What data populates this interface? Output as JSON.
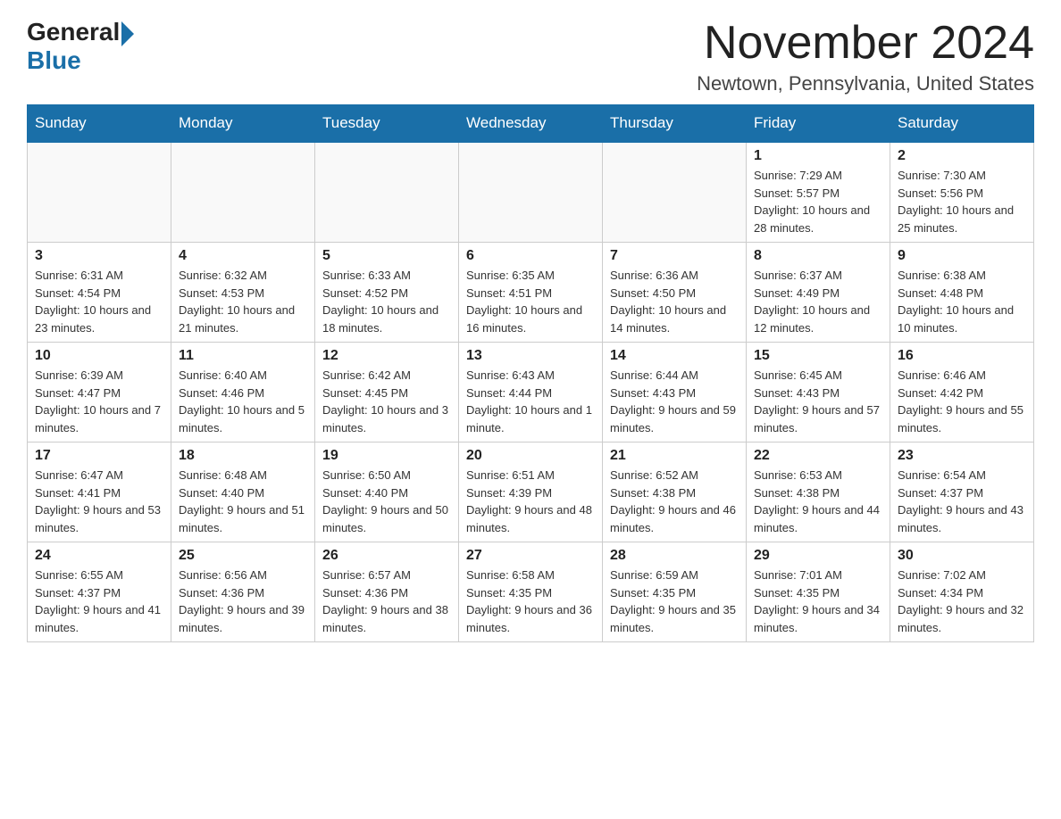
{
  "header": {
    "logo_general": "General",
    "logo_blue": "Blue",
    "month_title": "November 2024",
    "location": "Newtown, Pennsylvania, United States"
  },
  "weekdays": [
    "Sunday",
    "Monday",
    "Tuesday",
    "Wednesday",
    "Thursday",
    "Friday",
    "Saturday"
  ],
  "weeks": [
    {
      "days": [
        {
          "number": "",
          "info": ""
        },
        {
          "number": "",
          "info": ""
        },
        {
          "number": "",
          "info": ""
        },
        {
          "number": "",
          "info": ""
        },
        {
          "number": "",
          "info": ""
        },
        {
          "number": "1",
          "info": "Sunrise: 7:29 AM\nSunset: 5:57 PM\nDaylight: 10 hours and 28 minutes."
        },
        {
          "number": "2",
          "info": "Sunrise: 7:30 AM\nSunset: 5:56 PM\nDaylight: 10 hours and 25 minutes."
        }
      ]
    },
    {
      "days": [
        {
          "number": "3",
          "info": "Sunrise: 6:31 AM\nSunset: 4:54 PM\nDaylight: 10 hours and 23 minutes."
        },
        {
          "number": "4",
          "info": "Sunrise: 6:32 AM\nSunset: 4:53 PM\nDaylight: 10 hours and 21 minutes."
        },
        {
          "number": "5",
          "info": "Sunrise: 6:33 AM\nSunset: 4:52 PM\nDaylight: 10 hours and 18 minutes."
        },
        {
          "number": "6",
          "info": "Sunrise: 6:35 AM\nSunset: 4:51 PM\nDaylight: 10 hours and 16 minutes."
        },
        {
          "number": "7",
          "info": "Sunrise: 6:36 AM\nSunset: 4:50 PM\nDaylight: 10 hours and 14 minutes."
        },
        {
          "number": "8",
          "info": "Sunrise: 6:37 AM\nSunset: 4:49 PM\nDaylight: 10 hours and 12 minutes."
        },
        {
          "number": "9",
          "info": "Sunrise: 6:38 AM\nSunset: 4:48 PM\nDaylight: 10 hours and 10 minutes."
        }
      ]
    },
    {
      "days": [
        {
          "number": "10",
          "info": "Sunrise: 6:39 AM\nSunset: 4:47 PM\nDaylight: 10 hours and 7 minutes."
        },
        {
          "number": "11",
          "info": "Sunrise: 6:40 AM\nSunset: 4:46 PM\nDaylight: 10 hours and 5 minutes."
        },
        {
          "number": "12",
          "info": "Sunrise: 6:42 AM\nSunset: 4:45 PM\nDaylight: 10 hours and 3 minutes."
        },
        {
          "number": "13",
          "info": "Sunrise: 6:43 AM\nSunset: 4:44 PM\nDaylight: 10 hours and 1 minute."
        },
        {
          "number": "14",
          "info": "Sunrise: 6:44 AM\nSunset: 4:43 PM\nDaylight: 9 hours and 59 minutes."
        },
        {
          "number": "15",
          "info": "Sunrise: 6:45 AM\nSunset: 4:43 PM\nDaylight: 9 hours and 57 minutes."
        },
        {
          "number": "16",
          "info": "Sunrise: 6:46 AM\nSunset: 4:42 PM\nDaylight: 9 hours and 55 minutes."
        }
      ]
    },
    {
      "days": [
        {
          "number": "17",
          "info": "Sunrise: 6:47 AM\nSunset: 4:41 PM\nDaylight: 9 hours and 53 minutes."
        },
        {
          "number": "18",
          "info": "Sunrise: 6:48 AM\nSunset: 4:40 PM\nDaylight: 9 hours and 51 minutes."
        },
        {
          "number": "19",
          "info": "Sunrise: 6:50 AM\nSunset: 4:40 PM\nDaylight: 9 hours and 50 minutes."
        },
        {
          "number": "20",
          "info": "Sunrise: 6:51 AM\nSunset: 4:39 PM\nDaylight: 9 hours and 48 minutes."
        },
        {
          "number": "21",
          "info": "Sunrise: 6:52 AM\nSunset: 4:38 PM\nDaylight: 9 hours and 46 minutes."
        },
        {
          "number": "22",
          "info": "Sunrise: 6:53 AM\nSunset: 4:38 PM\nDaylight: 9 hours and 44 minutes."
        },
        {
          "number": "23",
          "info": "Sunrise: 6:54 AM\nSunset: 4:37 PM\nDaylight: 9 hours and 43 minutes."
        }
      ]
    },
    {
      "days": [
        {
          "number": "24",
          "info": "Sunrise: 6:55 AM\nSunset: 4:37 PM\nDaylight: 9 hours and 41 minutes."
        },
        {
          "number": "25",
          "info": "Sunrise: 6:56 AM\nSunset: 4:36 PM\nDaylight: 9 hours and 39 minutes."
        },
        {
          "number": "26",
          "info": "Sunrise: 6:57 AM\nSunset: 4:36 PM\nDaylight: 9 hours and 38 minutes."
        },
        {
          "number": "27",
          "info": "Sunrise: 6:58 AM\nSunset: 4:35 PM\nDaylight: 9 hours and 36 minutes."
        },
        {
          "number": "28",
          "info": "Sunrise: 6:59 AM\nSunset: 4:35 PM\nDaylight: 9 hours and 35 minutes."
        },
        {
          "number": "29",
          "info": "Sunrise: 7:01 AM\nSunset: 4:35 PM\nDaylight: 9 hours and 34 minutes."
        },
        {
          "number": "30",
          "info": "Sunrise: 7:02 AM\nSunset: 4:34 PM\nDaylight: 9 hours and 32 minutes."
        }
      ]
    }
  ]
}
